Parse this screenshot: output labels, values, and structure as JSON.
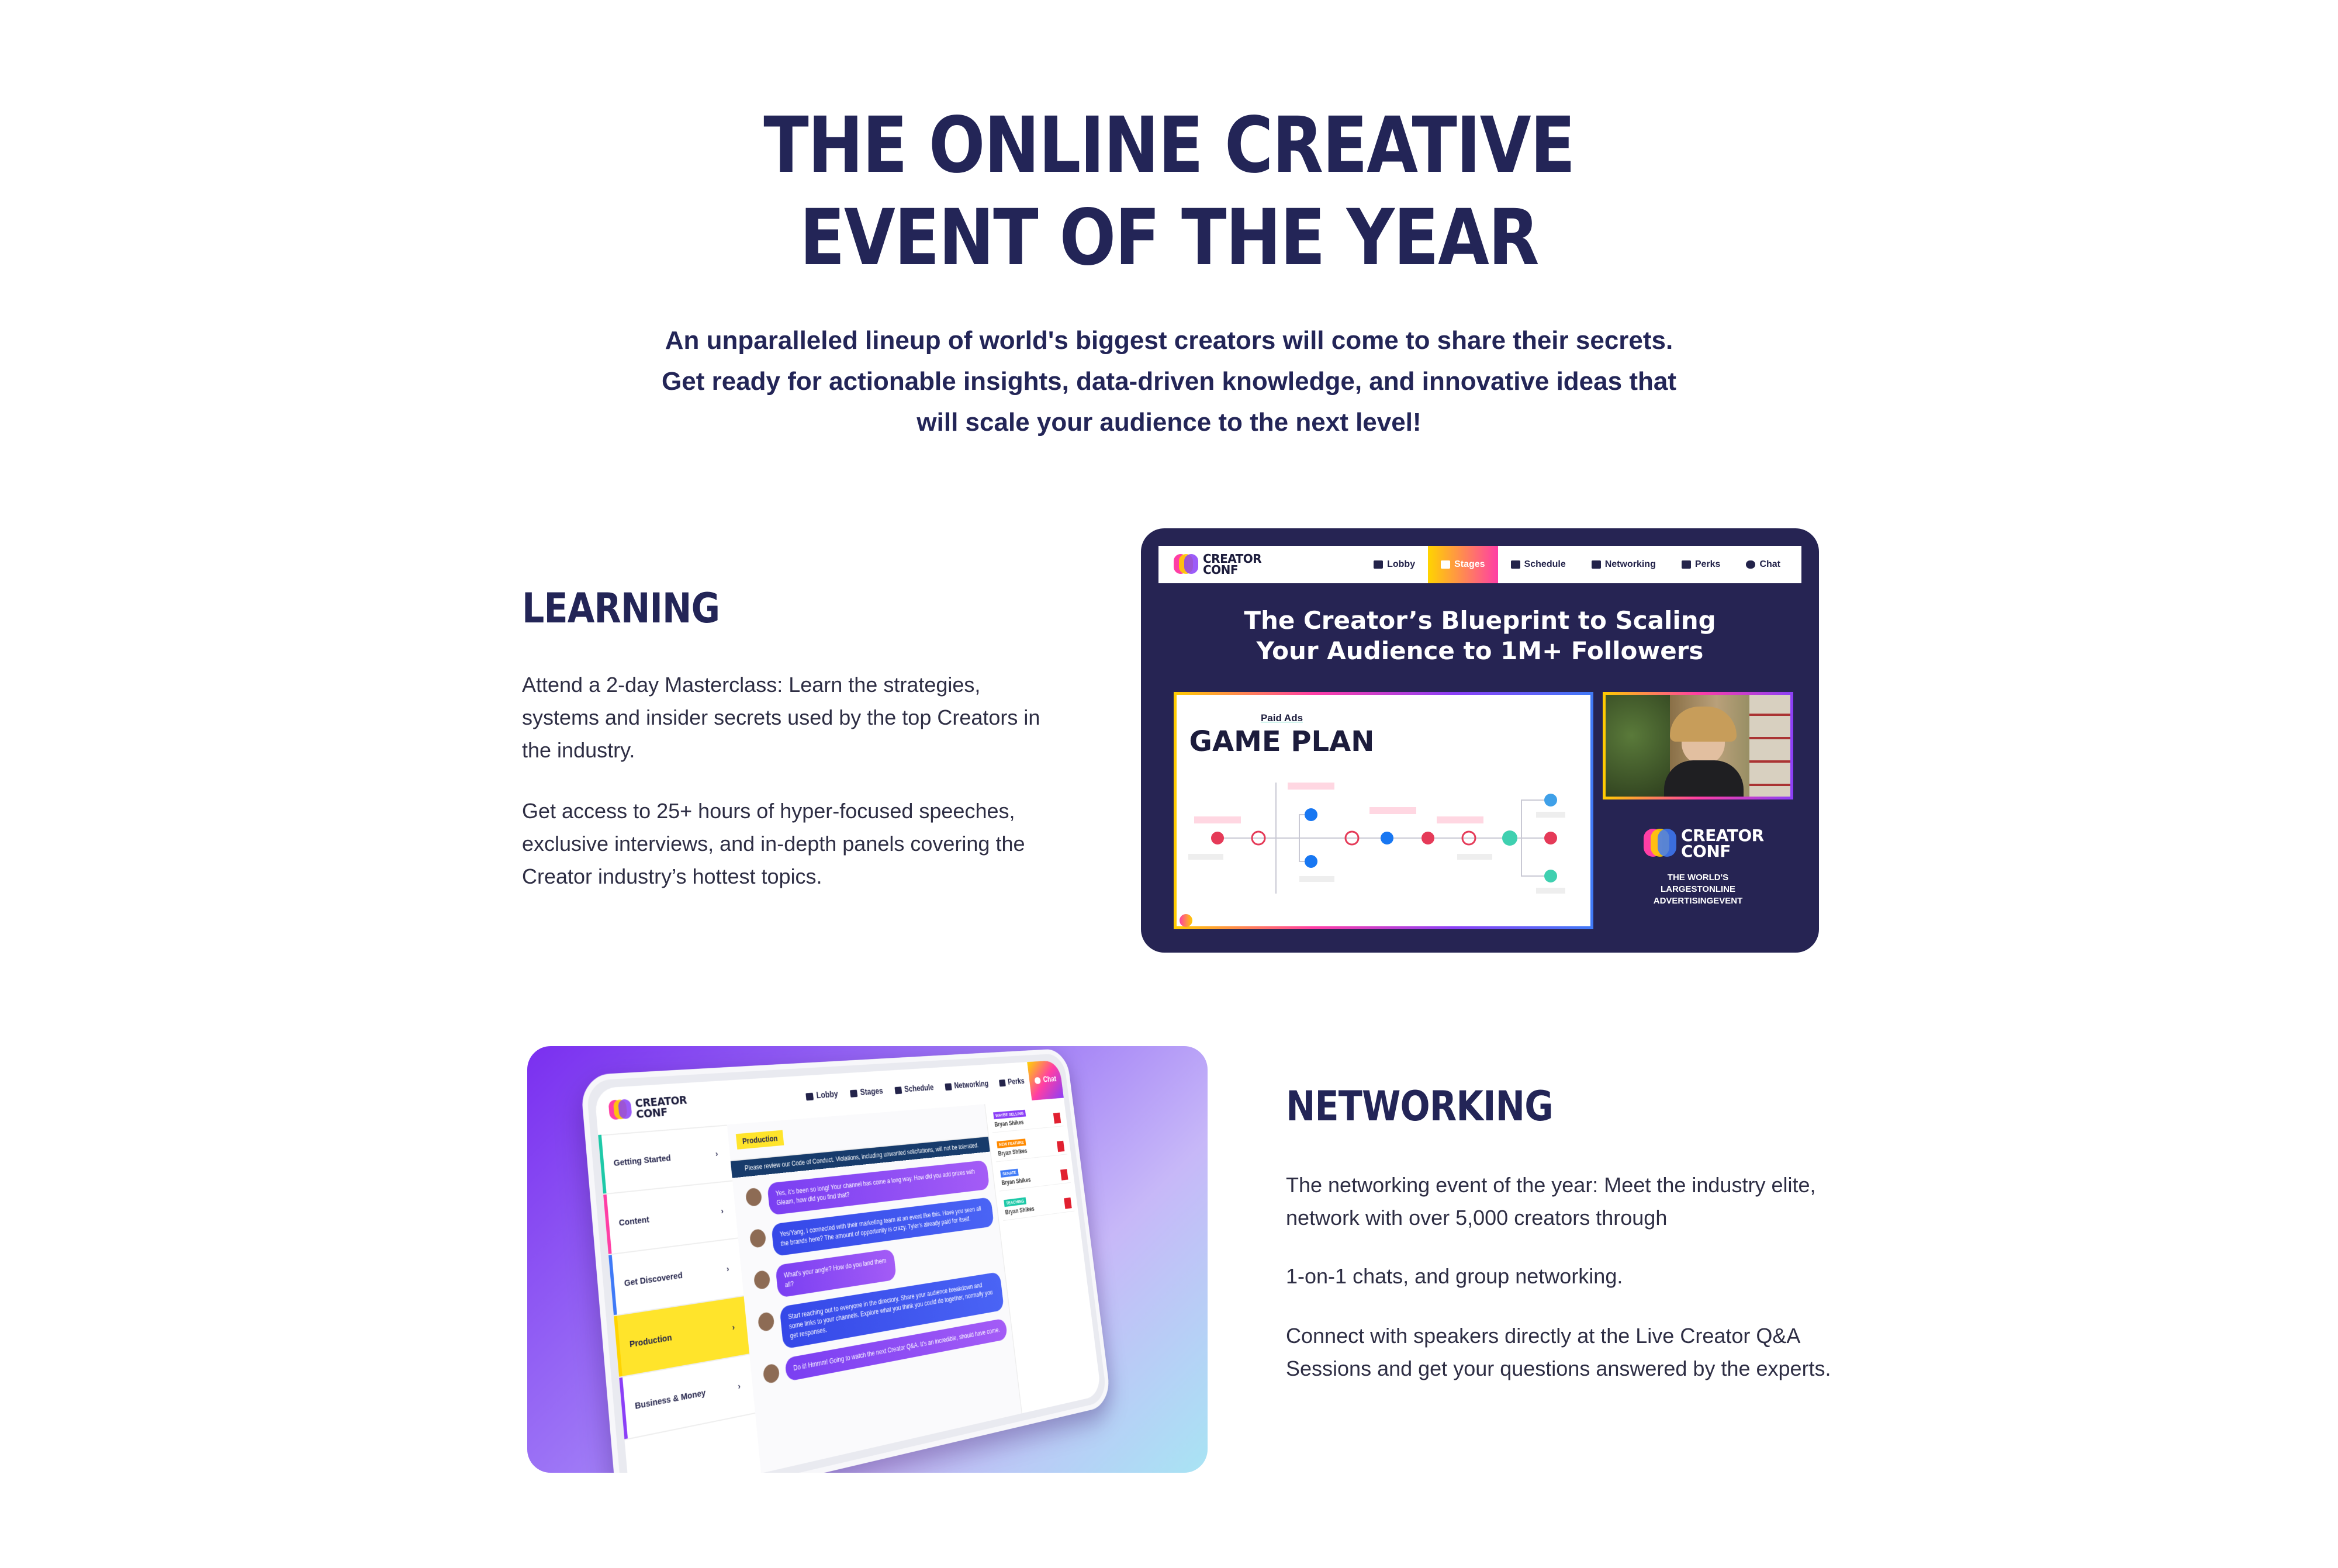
{
  "hero": {
    "title_lines": [
      "THE ONLINE CREATIVE",
      "EVENT OF THE YEAR"
    ],
    "subtitle_lines": [
      "An unparalleled lineup of world's biggest creators will come to share their secrets.",
      "Get ready for actionable insights, data-driven knowledge, and innovative ideas that",
      "will scale your audience to the next level!"
    ]
  },
  "learning": {
    "heading": "LEARNING",
    "paragraphs": [
      "Attend a 2-day Masterclass: Learn the strategies, systems and insider secrets used by the top Creators in the industry.",
      "Get access to 25+ hours of hyper-focused speeches, exclusive interviews, and in-depth panels covering the Creator industry’s hottest topics."
    ],
    "screenshot": {
      "logo_lines": [
        "CREATOR",
        "CONF"
      ],
      "nav": [
        "Lobby",
        "Stages",
        "Schedule",
        "Networking",
        "Perks",
        "Chat"
      ],
      "active_nav": "Stages",
      "title_lines": [
        "The Creator’s Blueprint to Scaling",
        "Your Audience to 1M+ Followers"
      ],
      "slide_kicker": "Paid Ads",
      "slide_heading": "GAME PLAN",
      "tagline_lines": [
        "THE WORLD'S",
        "LARGESTONLINE",
        "ADVERTISINGEVENT"
      ]
    }
  },
  "networking": {
    "heading": "NETWORKING",
    "paragraphs": [
      "The networking event of the year: Meet the industry elite, network with over 5,000 creators through",
      "1-on-1 chats, and group networking.",
      "Connect with speakers directly at the Live Creator Q&A Sessions and get your questions answered by the experts."
    ],
    "screenshot": {
      "logo_lines": [
        "CREATOR",
        "CONF"
      ],
      "nav": [
        "Lobby",
        "Stages",
        "Schedule",
        "Networking",
        "Perks",
        "Chat"
      ],
      "active_nav": "Chat",
      "sidebar": [
        "Getting Started",
        "Content",
        "Get Discovered",
        "Production",
        "Business & Money"
      ],
      "active_sidebar": "Production",
      "channel": "Production",
      "notice": "Please review our Code of Conduct. Violations, including unwanted solicitations, will not be tolerated.",
      "messages": [
        "Yes, it's been so long! Your channel has come a long way. How did you add prizes with Gleam, how did you find that?",
        "Yes/Yang, I connected with their marketing team at an event like this. Have you seen all the brands here? The amount of opportunity is crazy. Tyler's already paid for itself.",
        "What's your angle? How do you land them all?",
        "Start reaching out to everyone in the directory. Share your audience breakdown and some links to your channels. Explore what you think you could do together, normally you get responses.",
        "Do it! Hmmm! Going to watch the next Creator Q&A. It's an incredible, should have come."
      ],
      "feed_name": "Bryan Shikes",
      "feed_tags": [
        "WAYBE SELLING",
        "NEW FEATURE",
        "SENATE",
        "TEACHING"
      ]
    }
  },
  "colors": {
    "navy": "#232557",
    "stage_bg": "#262453",
    "accent_yellow": "#ffd400",
    "accent_pink": "#ff3ea5",
    "accent_purple": "#8b3ff7"
  }
}
